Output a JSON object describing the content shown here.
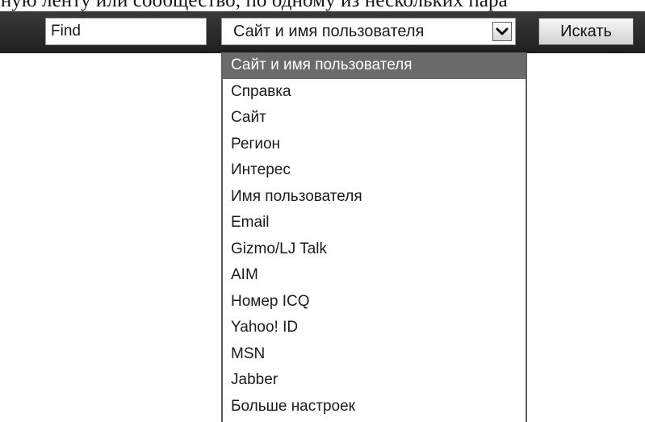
{
  "caption": {
    "text": "дную ленту или сообщество, по одному из нескольких пара"
  },
  "search_bar": {
    "input_value": "Find",
    "select": {
      "selected_value": "Сайт и имя пользователя",
      "arrow_icon": "chevron-down-icon"
    },
    "search_button_label": "Искать"
  },
  "dropdown": {
    "options": [
      "Сайт и имя пользователя",
      "Справка",
      "Сайт",
      "Регион",
      "Интерес",
      "Имя пользователя",
      "Email",
      "Gizmo/LJ Talk",
      "AIM",
      "Номер ICQ",
      "Yahoo! ID",
      "MSN",
      "Jabber",
      "Больше настроек"
    ],
    "highlighted_index": 0
  },
  "colors": {
    "toolbar": "#2b2b2b",
    "highlight": "#6b6b6b"
  }
}
